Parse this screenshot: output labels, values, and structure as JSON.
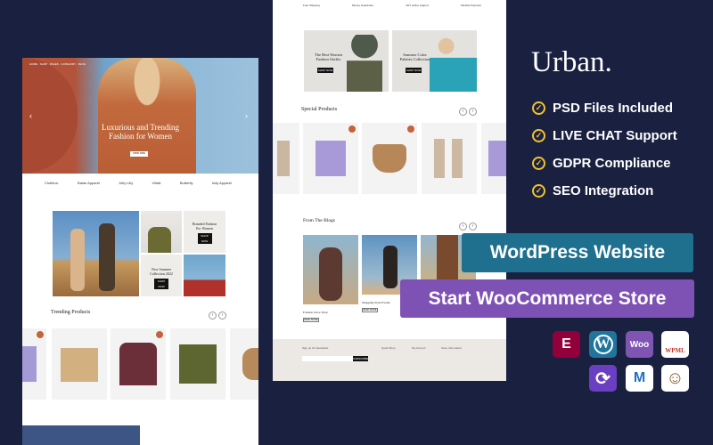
{
  "brand": {
    "title": "Urban."
  },
  "features": [
    "PSD Files Included",
    "LIVE CHAT Support",
    "GDPR Compliance",
    "SEO Integration"
  ],
  "cta": {
    "wordpress": "WordPress Website",
    "woocommerce": "Start WooCommerce Store"
  },
  "colors": {
    "background": "#1a2040",
    "check": "#f2c230",
    "wordpress_button": "#1f6f8f",
    "woo_button": "#7e52b5",
    "price": "#c5633a"
  },
  "plugins": [
    {
      "name": "Elementor",
      "icon": "elementor-icon",
      "label": "E"
    },
    {
      "name": "WordPress",
      "icon": "wordpress-icon",
      "label": "W"
    },
    {
      "name": "WooCommerce",
      "icon": "woocommerce-icon",
      "label": "Woo"
    },
    {
      "name": "WPML",
      "icon": "wpml-icon",
      "label": "WPML"
    },
    {
      "name": "Sync",
      "icon": "sync-icon",
      "label": "⟳"
    },
    {
      "name": "Mega Menu",
      "icon": "megamenu-icon",
      "label": "M"
    },
    {
      "name": "Mailchimp",
      "icon": "mailchimp-icon",
      "label": "☺"
    }
  ],
  "left_mockup": {
    "hero": {
      "title_line1": "Luxurious and Trending",
      "title_line2": "Fashion for Women",
      "button": "SHOP NOW"
    },
    "brands": [
      "Clothina.",
      "Balan Apparel",
      "Jelly Lilly",
      "Villa&",
      "Butterfly",
      "Indy Apparel"
    ],
    "collage": {
      "promo1_line1": "Branded Fashion",
      "promo1_line2": "For Women",
      "promo2_line1": "New Summer",
      "promo2_line2": "Collection 2022",
      "button": "SHOP NOW"
    },
    "trending": {
      "title": "Trending Products"
    }
  },
  "middle_mockup": {
    "features": [
      "Free Shipping",
      "Money Guarantee",
      "24/7 online support",
      "Flexible Payment"
    ],
    "banners": [
      {
        "line1": "The Best Women",
        "line2": "Fashion Outfits",
        "button": "SHOP NOW"
      },
      {
        "line1": "Summer Color",
        "line2": "Palettes Collection",
        "button": "SHOP NOW"
      }
    ],
    "special": {
      "title": "Special Products"
    },
    "blogs": {
      "title": "From The Blogs",
      "posts": [
        "Fashion Glow Wear",
        "Shopping Style Events"
      ],
      "button": "READ MORE"
    },
    "footer": {
      "signup": "Sign up for Newsletter",
      "subscribe": "SUBSCRIBE",
      "col1": "Quick Shop",
      "col2": "My Account",
      "col3": "Store Information"
    }
  }
}
